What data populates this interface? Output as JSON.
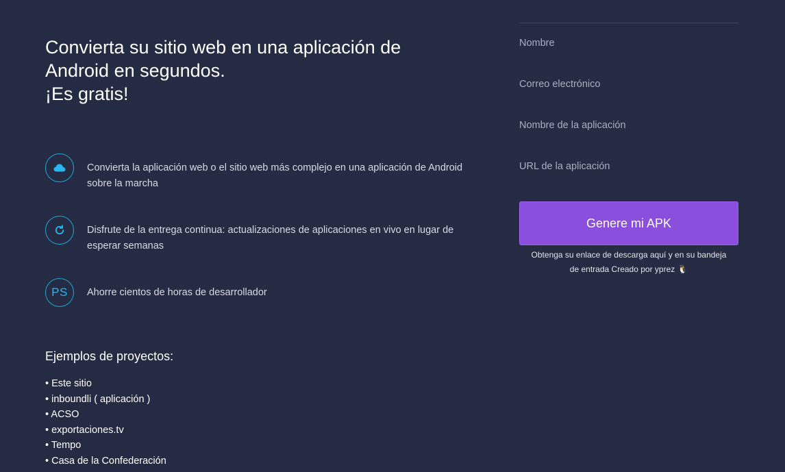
{
  "headline": {
    "line1": "Convierta su sitio web en una aplicación de",
    "line2": "Android en segundos.",
    "line3": "¡Es gratis!"
  },
  "features": [
    {
      "icon": "cloud-icon",
      "text": "Convierta la aplicación web o el sitio web más complejo en una aplicación de Android sobre la marcha"
    },
    {
      "icon": "refresh-icon",
      "text": "Disfrute de la entrega continua: actualizaciones de aplicaciones en vivo en lugar de esperar semanas"
    },
    {
      "icon": "ps-icon",
      "icon_text": "PS",
      "text": "Ahorre cientos de horas de desarrollador"
    }
  ],
  "examples": {
    "title": "Ejemplos de proyectos:",
    "items": [
      "Este sitio",
      "inboundli ( aplicación )",
      "ACSO",
      "exportaciones.tv",
      "Tempo",
      "Casa de la Confederación"
    ]
  },
  "form": {
    "name_placeholder": "Nombre",
    "email_placeholder": "Correo electrónico",
    "app_name_placeholder": "Nombre de la aplicación",
    "app_url_placeholder": "URL de la aplicación",
    "submit_label": "Genere mi APK",
    "note_line1": "Obtenga su enlace de descarga aquí y en su bandeja",
    "note_line2": "de entrada",
    "credit_label": "Creado por yprez",
    "credit_icon": "penguin-icon"
  },
  "colors": {
    "background": "#252b42",
    "accent_button": "#8a4fdd",
    "icon_blue": "#29b6f0"
  }
}
